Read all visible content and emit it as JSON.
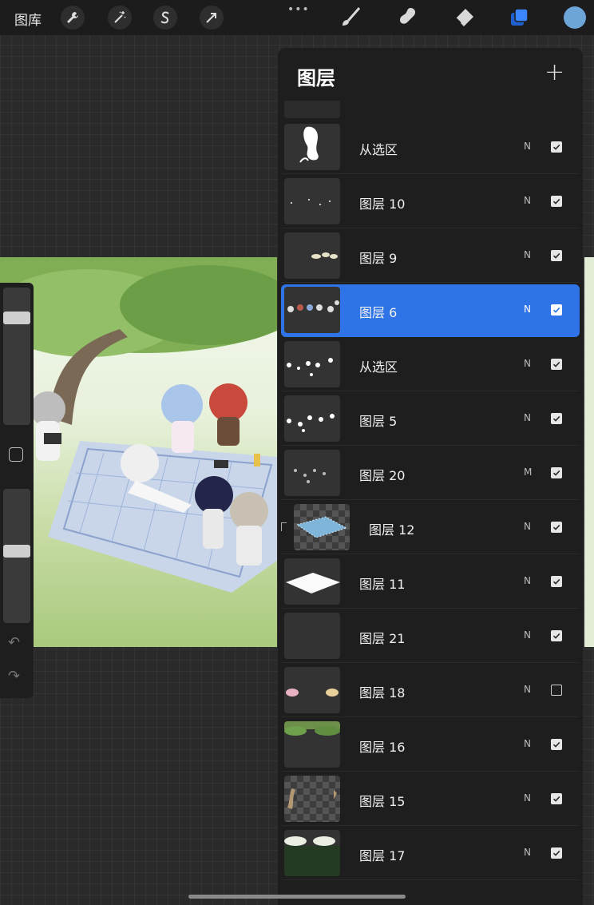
{
  "toolbar": {
    "gallery_label": "图库",
    "more_label": "•••",
    "left_icons": [
      "wrench-icon",
      "magic-wand-icon",
      "selection-icon",
      "transform-arrow-icon"
    ],
    "right_tools": [
      "brush-icon",
      "smudge-icon",
      "eraser-icon",
      "layers-icon"
    ],
    "active_tool": "layers-icon",
    "accent_color": "#2f74e6",
    "current_color": "#6ea5d8"
  },
  "sidebar": {
    "brush_size_level": 0.81,
    "opacity_level": 0.54,
    "undo_icon": "undo-arrow-icon",
    "redo_icon": "redo-arrow-icon"
  },
  "layers_panel": {
    "title": "图层",
    "add_label": "+",
    "layers": [
      {
        "name": "从选区",
        "blend": "N",
        "visible": true,
        "selected": false,
        "clipped": false
      },
      {
        "name": "图层 10",
        "blend": "N",
        "visible": true,
        "selected": false,
        "clipped": false
      },
      {
        "name": "图层 9",
        "blend": "N",
        "visible": true,
        "selected": false,
        "clipped": false
      },
      {
        "name": "图层 6",
        "blend": "N",
        "visible": true,
        "selected": true,
        "clipped": false
      },
      {
        "name": "从选区",
        "blend": "N",
        "visible": true,
        "selected": false,
        "clipped": false
      },
      {
        "name": "图层 5",
        "blend": "N",
        "visible": true,
        "selected": false,
        "clipped": false
      },
      {
        "name": "图层 20",
        "blend": "M",
        "visible": true,
        "selected": false,
        "clipped": false
      },
      {
        "name": "图层 12",
        "blend": "N",
        "visible": true,
        "selected": false,
        "clipped": true
      },
      {
        "name": "图层 11",
        "blend": "N",
        "visible": true,
        "selected": false,
        "clipped": false
      },
      {
        "name": "图层 21",
        "blend": "N",
        "visible": true,
        "selected": false,
        "clipped": false
      },
      {
        "name": "图层 18",
        "blend": "N",
        "visible": false,
        "selected": false,
        "clipped": false
      },
      {
        "name": "图层 16",
        "blend": "N",
        "visible": true,
        "selected": false,
        "clipped": false
      },
      {
        "name": "图层 15",
        "blend": "N",
        "visible": true,
        "selected": false,
        "clipped": false
      },
      {
        "name": "图层 17",
        "blend": "N",
        "visible": true,
        "selected": false,
        "clipped": false
      }
    ]
  }
}
